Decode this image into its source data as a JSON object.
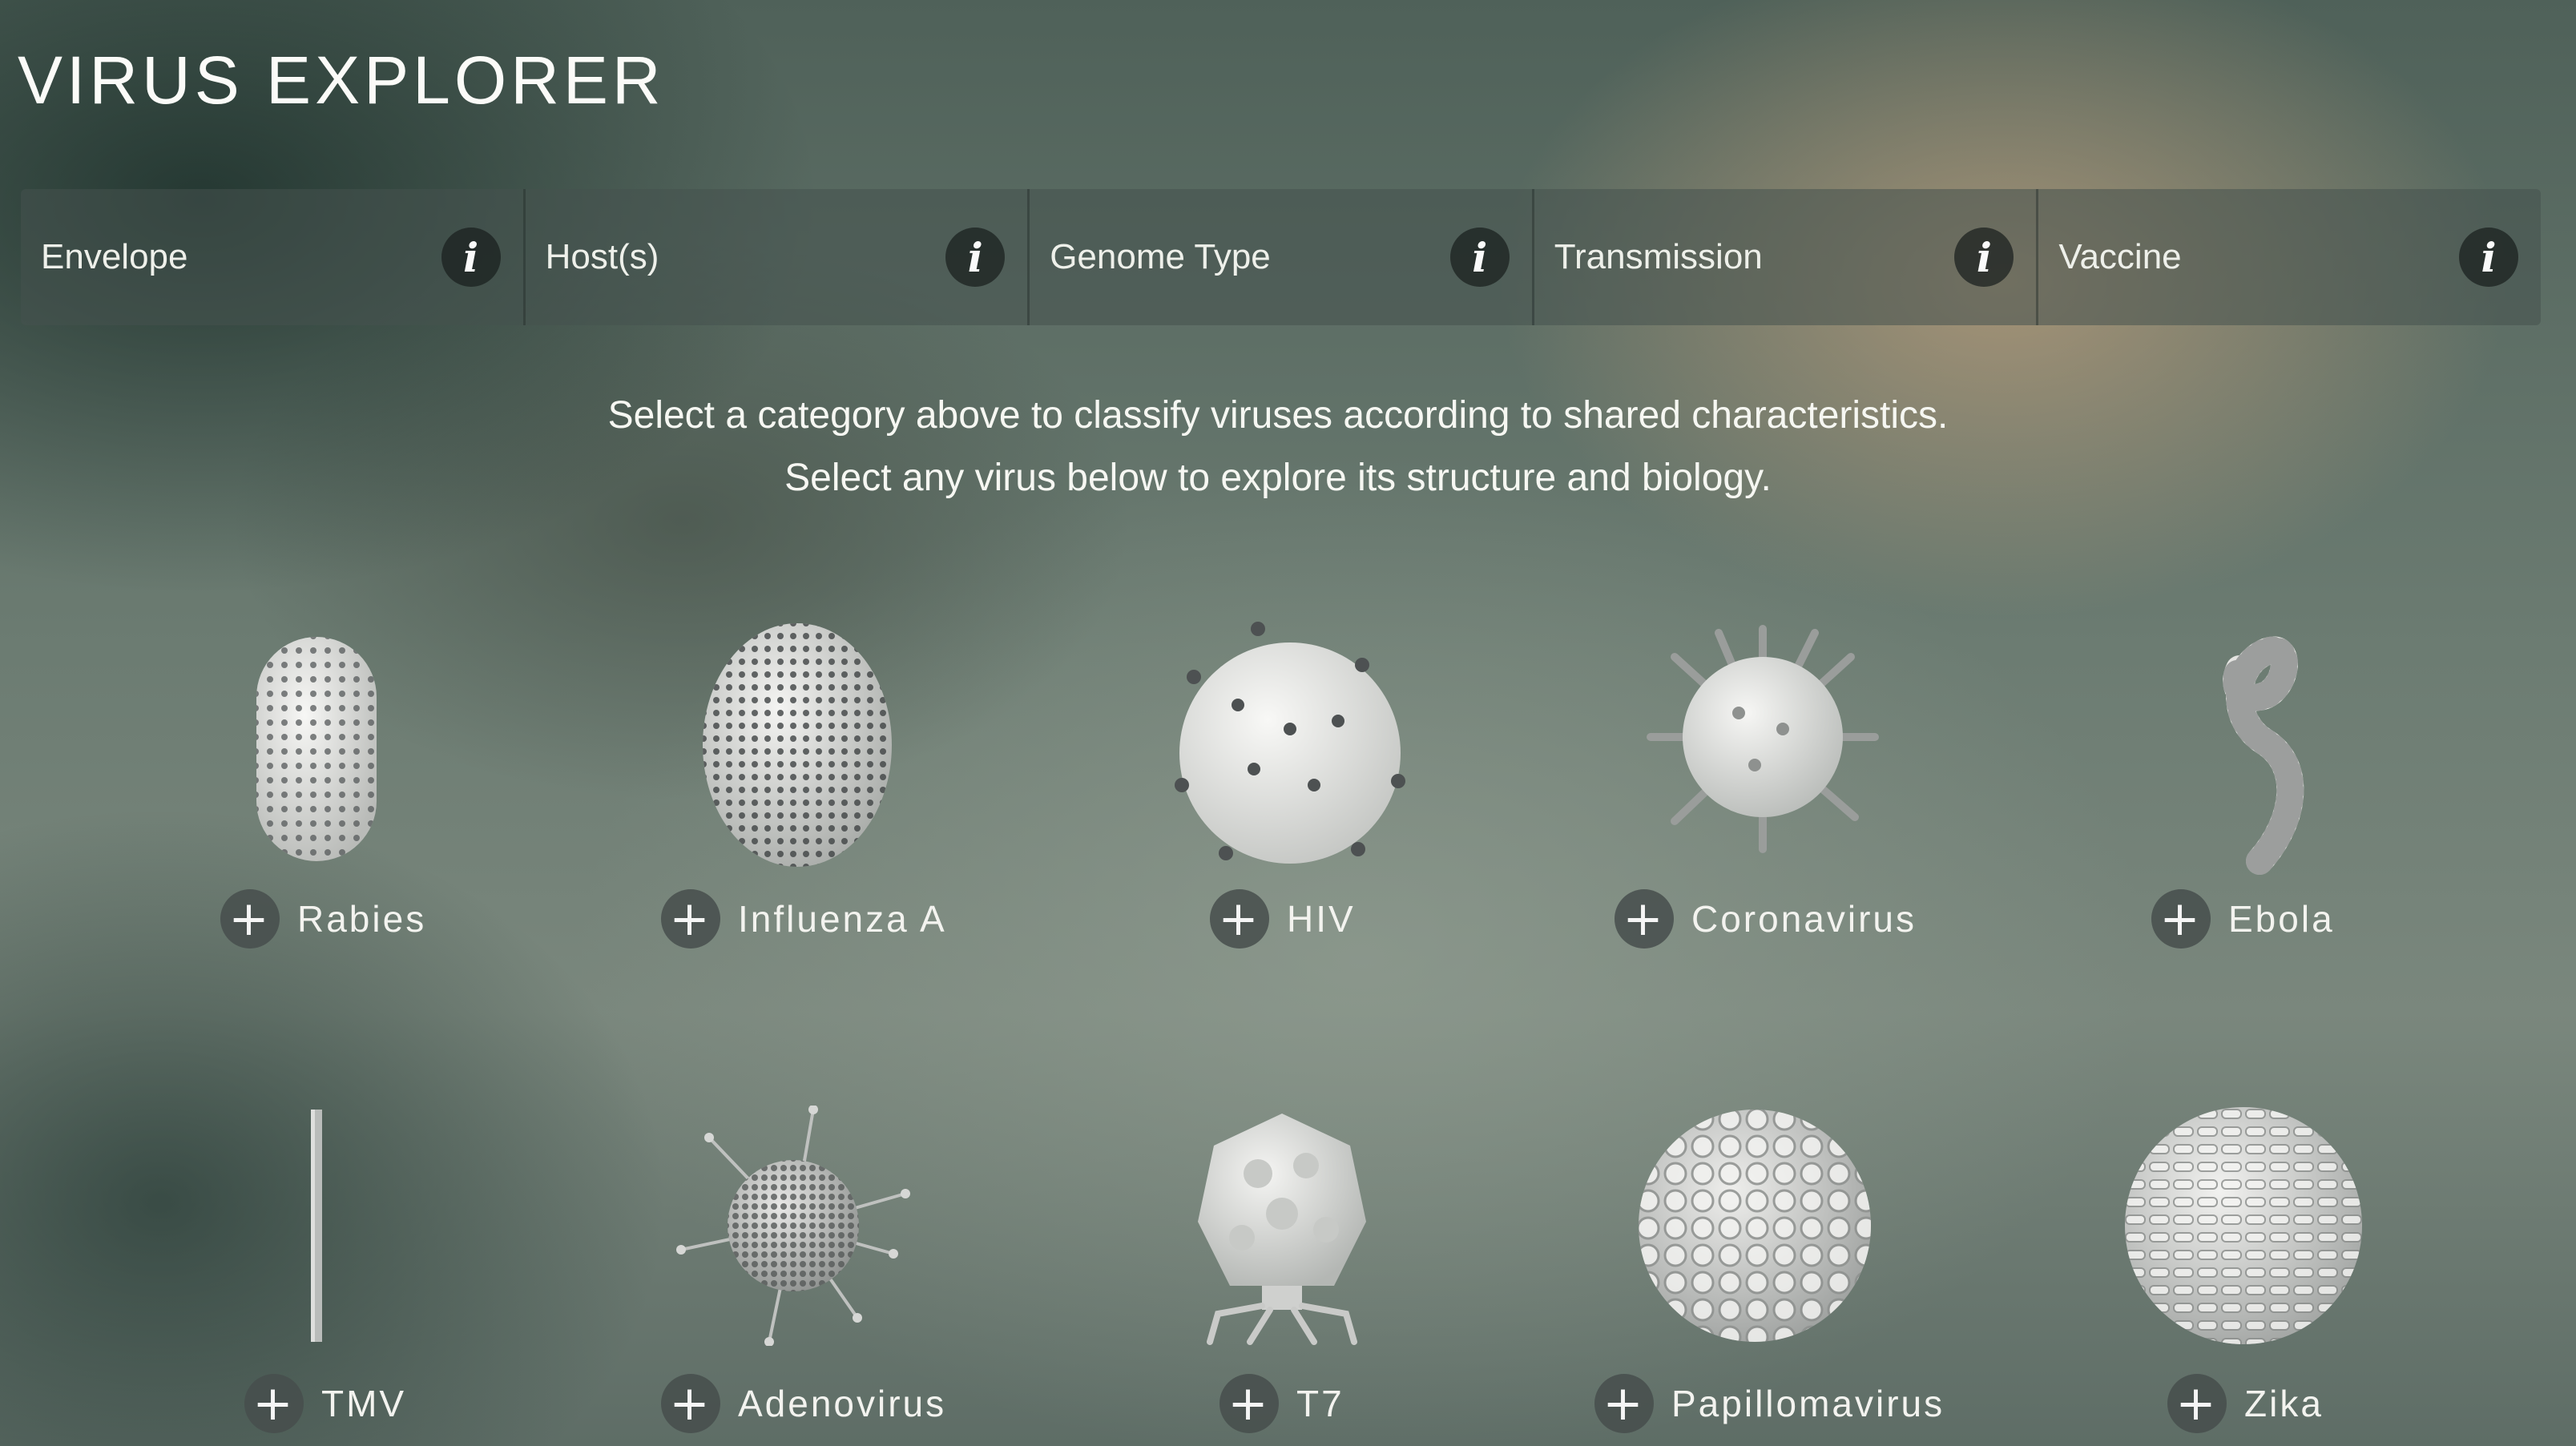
{
  "app": {
    "title": "VIRUS EXPLORER"
  },
  "filters": [
    {
      "label": "Envelope",
      "info_icon": "info-icon"
    },
    {
      "label": "Host(s)",
      "info_icon": "info-icon"
    },
    {
      "label": "Genome Type",
      "info_icon": "info-icon"
    },
    {
      "label": "Transmission",
      "info_icon": "info-icon"
    },
    {
      "label": "Vaccine",
      "info_icon": "info-icon"
    }
  ],
  "info_glyph": "i",
  "plus_glyph": "+",
  "instructions": {
    "line1": "Select a category above to classify viruses according to shared characteristics.",
    "line2": "Select any virus below to explore its structure and biology."
  },
  "viruses": [
    {
      "name": "Rabies",
      "icon": "rabies-virus-icon"
    },
    {
      "name": "Influenza A",
      "icon": "influenza-virus-icon"
    },
    {
      "name": "HIV",
      "icon": "hiv-virus-icon"
    },
    {
      "name": "Coronavirus",
      "icon": "coronavirus-icon"
    },
    {
      "name": "Ebola",
      "icon": "ebola-virus-icon"
    },
    {
      "name": "TMV",
      "icon": "tmv-virus-icon"
    },
    {
      "name": "Adenovirus",
      "icon": "adenovirus-icon"
    },
    {
      "name": "T7",
      "icon": "t7-phage-icon"
    },
    {
      "name": "Papillomavirus",
      "icon": "papillomavirus-icon"
    },
    {
      "name": "Zika",
      "icon": "zika-virus-icon"
    }
  ],
  "colors": {
    "virus_white": "#e9e9e6",
    "spike_dark": "#4a4d4c",
    "panel": "#46524e"
  }
}
